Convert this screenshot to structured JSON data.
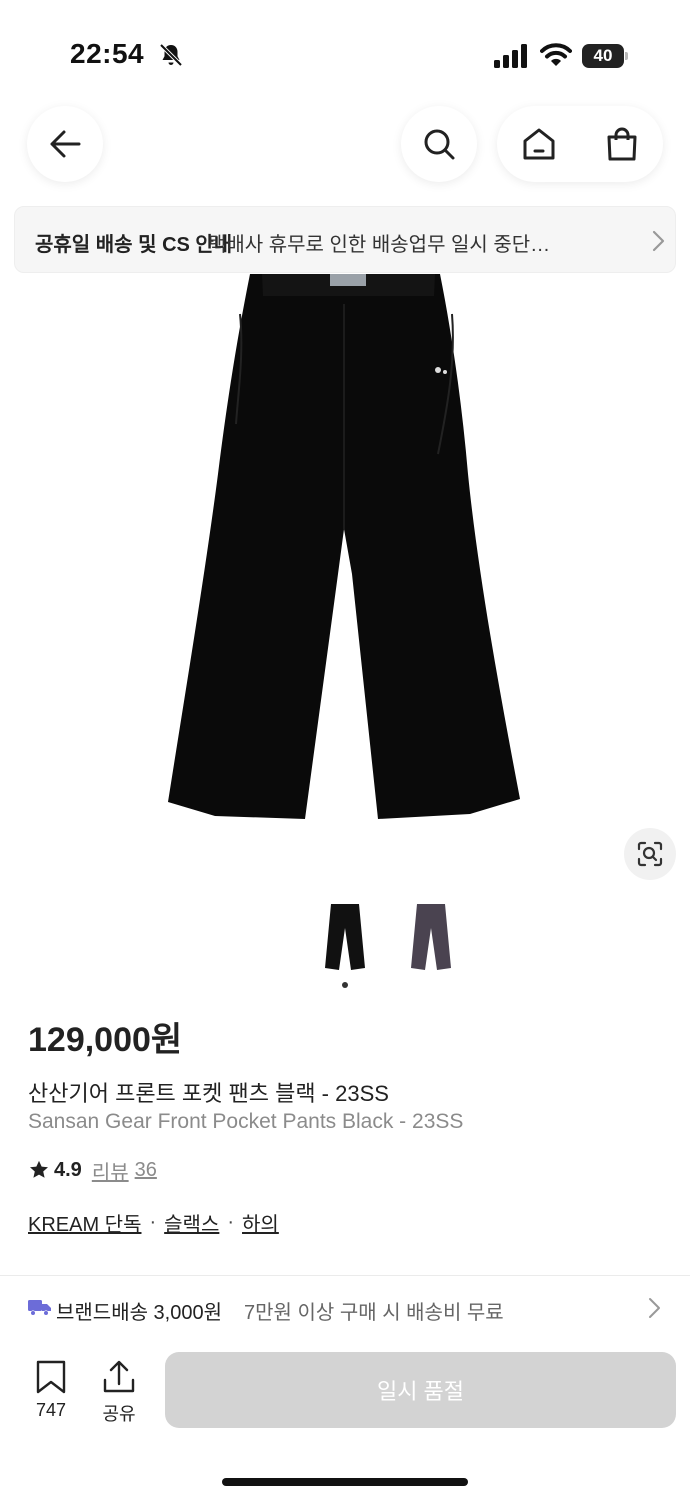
{
  "status_bar": {
    "time": "22:54",
    "battery": "40",
    "icons": [
      "bell-slash-icon",
      "cellular-signal-icon",
      "wifi-icon",
      "battery-icon"
    ]
  },
  "nav": {
    "icons": [
      "arrow-left-icon",
      "search-icon",
      "home-icon",
      "shopping-bag-icon"
    ]
  },
  "notice": {
    "title": "공휴일 배송 및 CS 안내",
    "text": "택배사 휴무로 인한 배송업무 일시 중단…"
  },
  "product": {
    "price": "129,000원",
    "name_ko": "산산기어 프론트 포켓 팬츠 블랙 - 23SS",
    "name_en": "Sansan Gear Front Pocket Pants Black - 23SS",
    "rating": "4.9",
    "review_label": "리뷰",
    "review_count": "36",
    "tags": [
      "KREAM 단독",
      "슬랙스",
      "하의"
    ],
    "thumbnail_colors": [
      "#111111",
      "#4a4350"
    ],
    "selected_thumbnail": 0
  },
  "shipping": {
    "title": "브랜드배송 3,000원",
    "description": "7만원 이상 구매 시 배송비 무료"
  },
  "bottom_bar": {
    "bookmark_count": "747",
    "share_label": "공유",
    "soldout_label": "일시 품절"
  },
  "colors": {
    "banner_bg": "#f6f6f6",
    "soldout_bg": "#d3d3d3",
    "truck_accent": "#6c6cd8"
  }
}
